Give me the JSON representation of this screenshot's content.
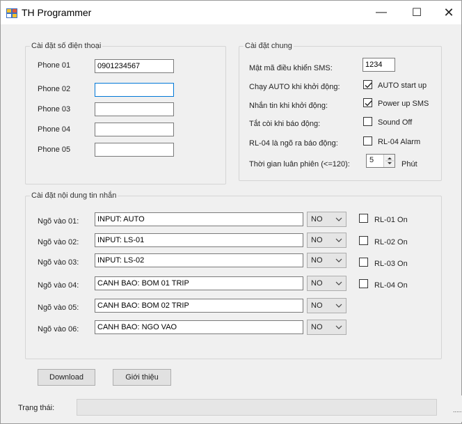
{
  "window": {
    "title": "TH Programmer",
    "minimize_glyph": "—",
    "maximize_glyph": "☐",
    "close_glyph": "✕"
  },
  "phone_group": {
    "legend": "Cài đặt số điện thoại",
    "phones": [
      {
        "label": "Phone 01",
        "value": "0901234567"
      },
      {
        "label": "Phone 02",
        "value": ""
      },
      {
        "label": "Phone 03",
        "value": ""
      },
      {
        "label": "Phone 04",
        "value": ""
      },
      {
        "label": "Phone 05",
        "value": ""
      }
    ]
  },
  "general_group": {
    "legend": "Cài đặt chung",
    "sms_code_label": "Mật mã điều khiển SMS:",
    "sms_code_value": "1234",
    "auto_start_label": "Chạy AUTO khi khởi động:",
    "auto_start_check": "AUTO start up",
    "auto_start_checked": true,
    "power_sms_label": "Nhắn tin khi khởi động:",
    "power_sms_check": "Power up SMS",
    "power_sms_checked": true,
    "sound_off_label": "Tắt còi khi báo động:",
    "sound_off_check": "Sound Off",
    "sound_off_checked": false,
    "rl04_label": "RL-04 là ngõ ra báo động:",
    "rl04_check": "RL-04 Alarm",
    "rl04_checked": false,
    "rotation_label": "Thời gian luân phiên (<=120):",
    "rotation_value": "5",
    "rotation_unit": "Phút"
  },
  "message_group": {
    "legend": "Cài đặt nội dung tin nhắn",
    "inputs": [
      {
        "label": "Ngõ vào 01:",
        "message": "INPUT: AUTO",
        "mode": "NO",
        "relay": "RL-01 On",
        "relay_checked": false
      },
      {
        "label": "Ngõ vào 02:",
        "message": "INPUT: LS-01",
        "mode": "NO",
        "relay": "RL-02 On",
        "relay_checked": false
      },
      {
        "label": "Ngõ vào 03:",
        "message": "INPUT: LS-02",
        "mode": "NO",
        "relay": "RL-03 On",
        "relay_checked": false
      },
      {
        "label": "Ngõ vào 04:",
        "message": "CANH BAO: BOM 01 TRIP",
        "mode": "NO",
        "relay": "RL-04 On",
        "relay_checked": false
      },
      {
        "label": "Ngõ vào 05:",
        "message": "CANH BAO: BOM 02 TRIP",
        "mode": "NO"
      },
      {
        "label": "Ngõ vào 06:",
        "message": "CANH BAO: NGO VAO",
        "mode": "NO"
      }
    ]
  },
  "buttons": {
    "download": "Download",
    "about": "Giới thiệu"
  },
  "status": {
    "label": "Trạng thái:",
    "value": "",
    "grip": "......"
  }
}
